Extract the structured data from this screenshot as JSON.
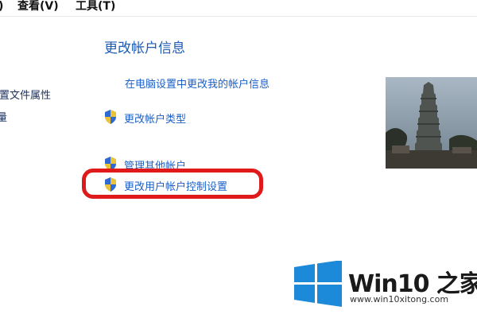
{
  "menu": {
    "partial_close_paren": ")",
    "view": "查看(V)",
    "tools": "工具(T)"
  },
  "left_pane": {
    "item1": "配置文件属性",
    "item2": "量"
  },
  "main": {
    "heading": "更改帐户信息",
    "link_pc_settings": "在电脑设置中更改我的帐户信息",
    "link_change_type": "更改帐户类型",
    "link_manage_other": "管理其他帐户",
    "link_uac_settings": "更改用户帐户控制设置"
  },
  "watermark": {
    "brand": "Win10 之家",
    "url": "www.win10xitong.com",
    "logo_color": "#1c8ad8"
  },
  "colors": {
    "heading": "#1e5bb3",
    "link": "#1a5fc8",
    "highlight": "#e01a1a"
  }
}
